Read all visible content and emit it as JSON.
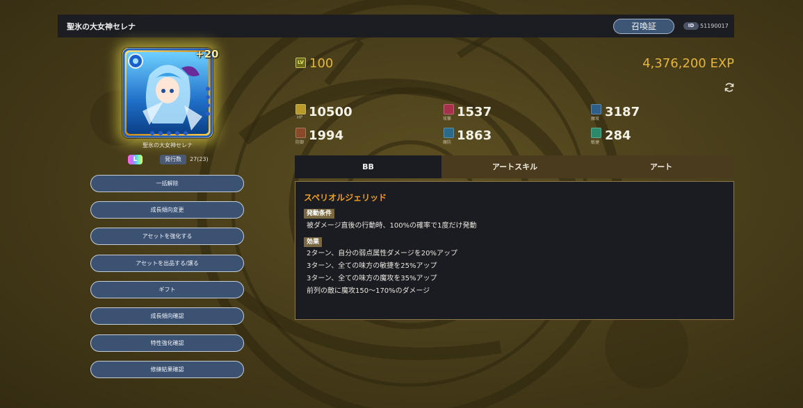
{
  "header": {
    "title": "聖氷の大女神セレナ",
    "summon_button": "召喚証",
    "id_label": "ID",
    "id_value": "51190017"
  },
  "unit": {
    "portrait_icon": "unit-portrait",
    "plus_level": "+20",
    "name": "聖氷の大女神セレナ",
    "rarity_label": "L",
    "issue_label": "発行数",
    "issue_value": "27(23)"
  },
  "actions": [
    "一括解除",
    "成長傾向変更",
    "アセットを強化する",
    "アセットを出品する/譲る",
    "ギフト",
    "成長傾向確認",
    "特性強化確認",
    "修練結果確認"
  ],
  "level": {
    "icon_label": "LV",
    "value": "100",
    "exp": "4,376,200 EXP"
  },
  "stats": [
    {
      "key": "HP",
      "sub": "HP",
      "value": "10500",
      "color": "#b89a2a",
      "icon": "hp-icon"
    },
    {
      "key": "ATK",
      "sub": "攻撃",
      "value": "1537",
      "color": "#a8304a",
      "icon": "attack-icon"
    },
    {
      "key": "MATK",
      "sub": "魔攻",
      "value": "3187",
      "color": "#2e5f8a",
      "icon": "magic-attack-icon"
    },
    {
      "key": "DEF",
      "sub": "防御",
      "value": "1994",
      "color": "#8a4a2a",
      "icon": "defense-icon"
    },
    {
      "key": "MDEF",
      "sub": "魔防",
      "value": "1863",
      "color": "#2a6a8a",
      "icon": "magic-defense-icon"
    },
    {
      "key": "AGI",
      "sub": "敏捷",
      "value": "284",
      "color": "#2a8a6a",
      "icon": "agility-icon"
    }
  ],
  "tabs": [
    "BB",
    "アートスキル",
    "アート"
  ],
  "skill": {
    "name": "スペリオルジェリッド",
    "trigger_label": "発動条件",
    "trigger_text": "被ダメージ直後の行動時、100%の確率で1度だけ発動",
    "effect_label": "効果",
    "effects": [
      "2ターン、自分の弱点属性ダメージを20%アップ",
      "3ターン、全ての味方の敏捷を25%アップ",
      "3ターン、全ての味方の魔攻を35%アップ",
      "前列の敵に魔攻150～170%のダメージ"
    ]
  },
  "colors": {
    "accent_gold": "#e5b53a",
    "skill_orange": "#f0a020",
    "button_blue": "#3b5272",
    "panel_dark": "#1b1c21"
  }
}
